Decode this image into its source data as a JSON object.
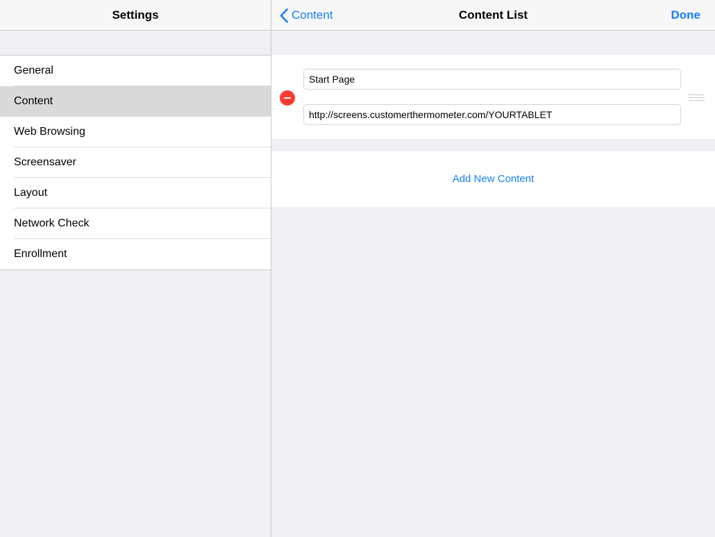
{
  "master": {
    "title": "Settings",
    "items": [
      {
        "label": "General"
      },
      {
        "label": "Content"
      },
      {
        "label": "Web Browsing"
      },
      {
        "label": "Screensaver"
      },
      {
        "label": "Layout"
      },
      {
        "label": "Network Check"
      },
      {
        "label": "Enrollment"
      }
    ],
    "selected_item": "Content"
  },
  "detail": {
    "back_label": "Content",
    "title": "Content List",
    "done_label": "Done",
    "content_items": [
      {
        "title_value": "Start Page",
        "url_value": "http://screens.customerthermometer.com/YOURTABLET"
      }
    ],
    "add_new_label": "Add New Content"
  },
  "colors": {
    "accent": "#157efb",
    "delete": "#fd3b30",
    "selected_row": "#d9d9d9",
    "background": "#efeff4"
  },
  "icons": {
    "back": "chevron-left-icon",
    "delete": "minus-circle-icon",
    "reorder": "reorder-handle-icon"
  }
}
